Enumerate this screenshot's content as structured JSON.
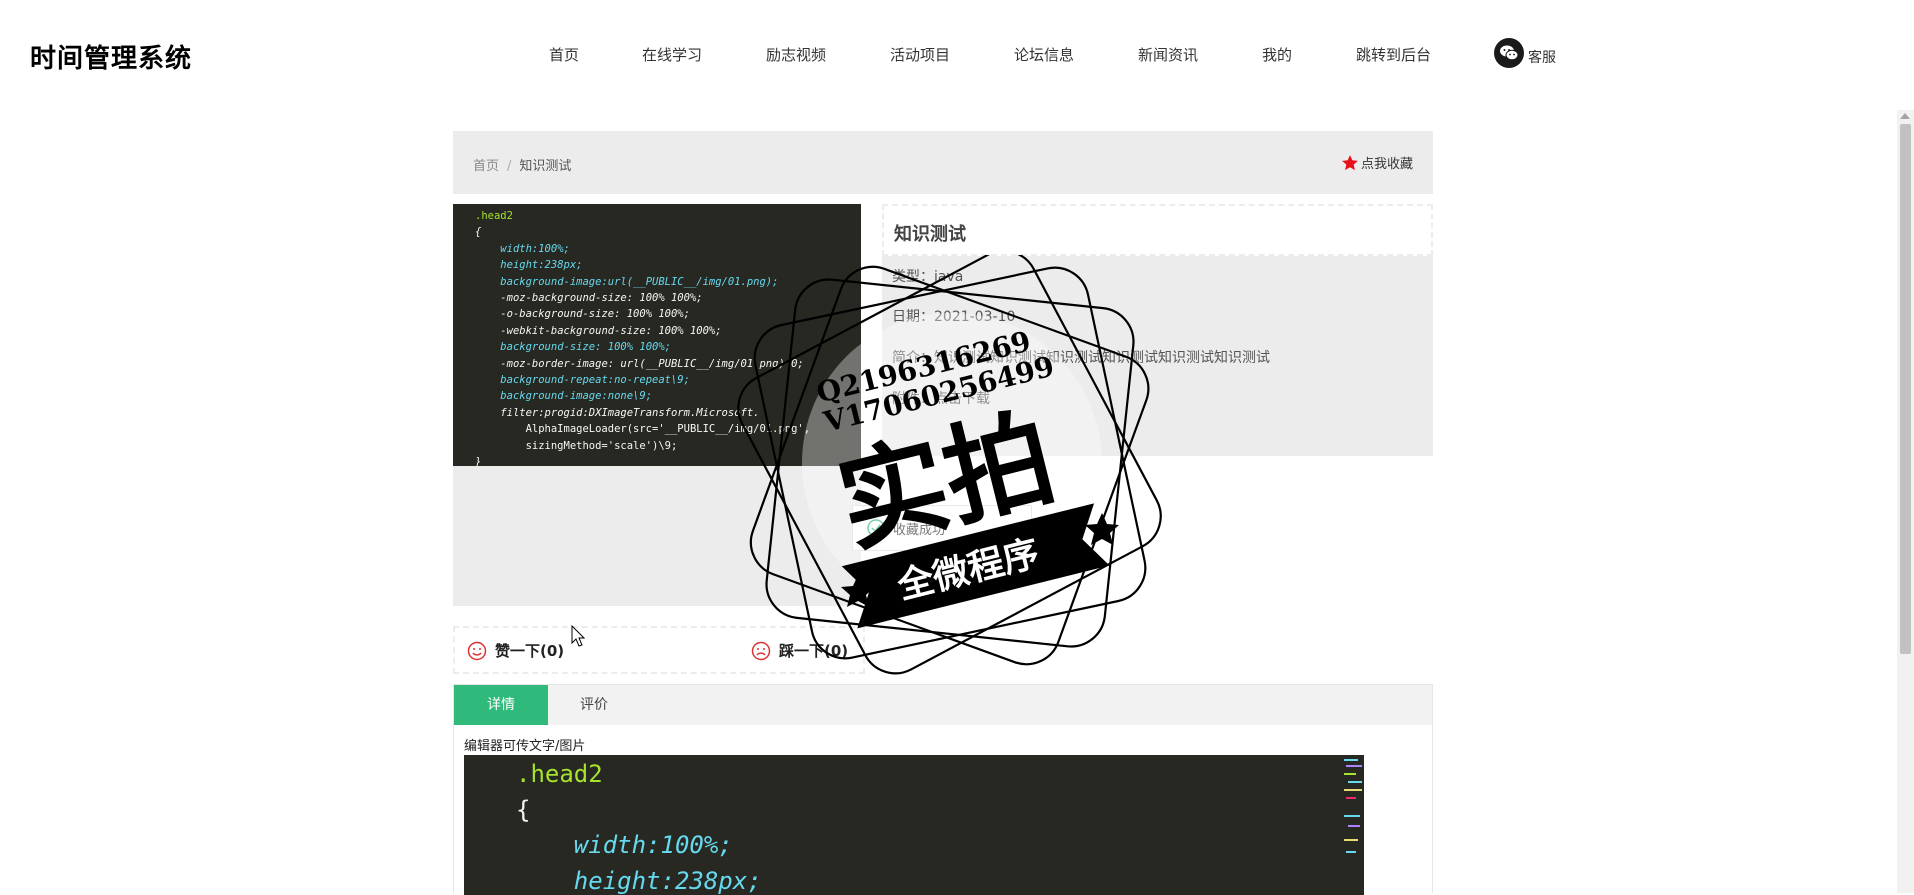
{
  "header": {
    "logo": "时间管理系统",
    "nav": [
      "首页",
      "在线学习",
      "励志视频",
      "活动项目",
      "论坛信息",
      "新闻资讯",
      "我的",
      "跳转到后台"
    ],
    "service_label": "客服"
  },
  "breadcrumb": {
    "home": "首页",
    "separator": "/",
    "current": "知识测试"
  },
  "favorite_label": "点我收藏",
  "image_code": [
    ".head2",
    "{",
    "width:100%;",
    "height:238px;",
    "background-image:url(__PUBLIC__/img/01.png);",
    "-moz-background-size: 100% 100%;",
    "-o-background-size: 100% 100%;",
    "-webkit-background-size: 100% 100%;",
    "background-size: 100% 100%;",
    "-moz-border-image: url(__PUBLIC__/img/01.png) 0;",
    "background-repeat:no-repeat\\9;",
    "background-image:none\\9;",
    "filter:progid:DXImageTransform.Microsoft.",
    "AlphaImageLoader(src='__PUBLIC__/img/01.png',",
    "sizingMethod='scale')\\9;",
    "}"
  ],
  "info": {
    "title": "知识测试",
    "type_row": "类型：java",
    "date_row": "日期：2021-03-10",
    "desc_row": "简介：知识测试知识测试知识测试知识测试知识测试知识测试",
    "file_row": "附件：点击下载"
  },
  "collect_success": "收藏成功",
  "votes": {
    "like": "赞一下(0)",
    "dislike": "踩一下(0)"
  },
  "tabs": {
    "detail": "详情",
    "review": "评价"
  },
  "detail": {
    "caption": "编辑器可传文字/图片",
    "code_lines": [
      ".head2",
      "{",
      "width:100%;",
      "height:238px;"
    ]
  },
  "stamp": {
    "contact_q": "Q2196316269",
    "contact_v": "V17060256499",
    "big_text": "实拍",
    "banner_text": "全微程序"
  },
  "colors": {
    "accent_green": "#2fb97a",
    "star_red": "#e8101b",
    "code_bg": "#272822"
  }
}
